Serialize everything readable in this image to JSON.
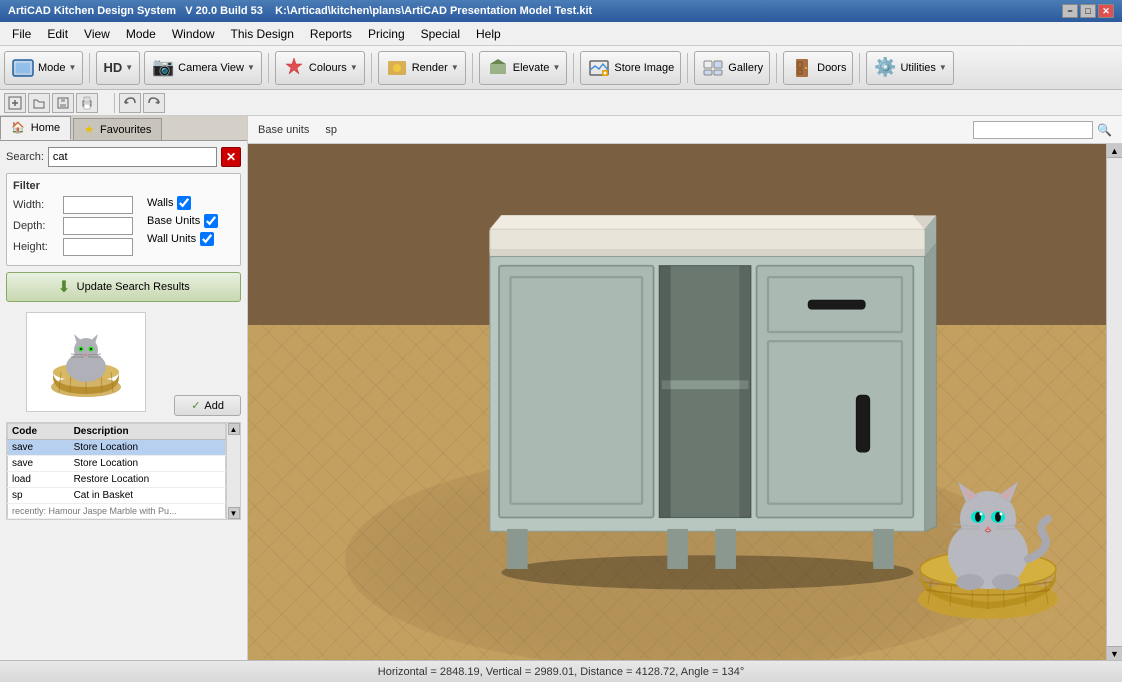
{
  "title_bar": {
    "app_name": "ArtiCAD Kitchen Design System",
    "version": "V 20.0 Build 53",
    "file_path": "K:\\Articad\\kitchen\\plans\\ArtiCAD Presentation Model Test.kit",
    "min_label": "−",
    "max_label": "□",
    "close_label": "✕"
  },
  "menu": {
    "items": [
      "File",
      "Edit",
      "View",
      "Mode",
      "Window",
      "This Design",
      "Reports",
      "Pricing",
      "Special",
      "Help"
    ]
  },
  "toolbar": {
    "mode_label": "Mode",
    "hd_label": "HD",
    "camera_view_label": "Camera View",
    "colours_label": "Colours",
    "render_label": "Render",
    "elevate_label": "Elevate",
    "store_image_label": "Store Image",
    "gallery_label": "Gallery",
    "doors_label": "Doors",
    "utilities_label": "Utilities",
    "caret": "▼"
  },
  "tabs": {
    "home_label": "Home",
    "favourites_label": "Favourites"
  },
  "search": {
    "label": "Search:",
    "value": "cat",
    "placeholder": ""
  },
  "filter": {
    "title": "Filter",
    "width_label": "Width:",
    "depth_label": "Depth:",
    "height_label": "Height:",
    "walls_label": "Walls",
    "base_units_label": "Base Units",
    "wall_units_label": "Wall Units",
    "walls_checked": true,
    "base_units_checked": true,
    "wall_units_checked": true
  },
  "update_btn": {
    "label": "Update Search Results",
    "icon": "↓"
  },
  "add_btn": {
    "label": "Add",
    "icon": "✓"
  },
  "nav": {
    "base_units_label": "Base units",
    "sp_label": "sp",
    "search_placeholder": ""
  },
  "results_table": {
    "headers": [
      "Code",
      "Description"
    ],
    "rows": [
      {
        "code": "save",
        "description": "Store Location",
        "selected": true
      },
      {
        "code": "save",
        "description": "Store Location"
      },
      {
        "code": "load",
        "description": "Restore Location"
      },
      {
        "code": "sp",
        "description": "Cat in Basket"
      }
    ],
    "extra_row": "recently: Hamour Jaspe Marble with Pu..."
  },
  "status_bar": {
    "text": "Horizontal = 2848.19, Vertical = 2989.01, Distance = 4128.72, Angle = 134°"
  },
  "preview": {
    "alt": "Cat in basket preview image"
  },
  "icons": {
    "search": "🔍",
    "camera": "📷",
    "paint": "🎨",
    "render": "🖼",
    "elevate": "📐",
    "store": "💾",
    "gallery": "🖼",
    "door": "🚪",
    "utilities": "⚙",
    "mode_arrow": "▼",
    "home": "🏠",
    "star": "★",
    "update_arrow": "⬇",
    "add_check": "✓",
    "magnifier": "🔍"
  }
}
